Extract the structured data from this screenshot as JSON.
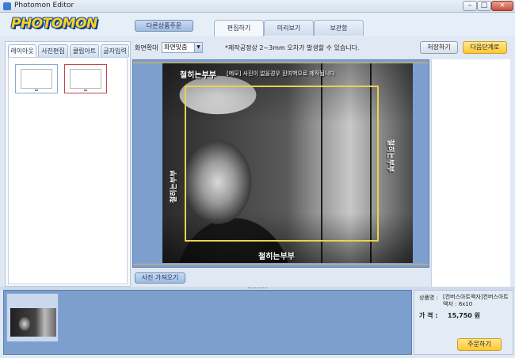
{
  "window": {
    "title": "Photomon Editor",
    "minimize": "–",
    "maximize": "□",
    "close": "×"
  },
  "header": {
    "logo": "PHOTOMON",
    "other_order": "다른상품주문",
    "tabs": [
      {
        "label": "편집하기",
        "active": true
      },
      {
        "label": "미리보기",
        "active": false
      },
      {
        "label": "보관함",
        "active": false
      }
    ]
  },
  "left_panel": {
    "tabs": [
      {
        "label": "레이아웃",
        "active": true
      },
      {
        "label": "사진편집",
        "active": false
      },
      {
        "label": "클립아트",
        "active": false
      },
      {
        "label": "글자입력",
        "active": false
      }
    ]
  },
  "toolbar": {
    "zoom_label": "화면확대",
    "zoom_value": "화면맞춤",
    "notice": "*제작공정상 2~3mm 오차가 발생할 수 있습니다.",
    "save": "저장하기",
    "next": "다음단계로"
  },
  "canvas": {
    "caption_top": "철히는부부",
    "caption_top_note": "[메모] 사진이 없을경우 흰여백으로 제작됩니다",
    "caption_left": "철히는부부",
    "caption_right": "철히는부부",
    "caption_bottom": "철히는부부"
  },
  "import_button": "사진 가져오기",
  "order": {
    "product_label": "상품명 :",
    "product_name": "[컨버스아트액자]컨버스아트액자 : 8x10",
    "price_label": "가  격 :",
    "price_value": "15,750 원",
    "order_button": "주문하기"
  },
  "colors": {
    "accent_yellow": "#ffc733",
    "canvas_bg": "#7c9fcd",
    "safe_frame": "#ead24a"
  }
}
